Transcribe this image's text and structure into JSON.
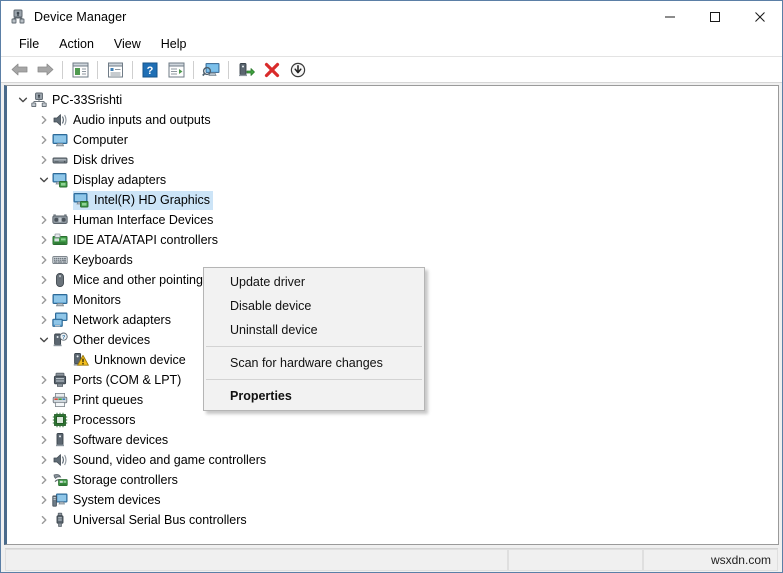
{
  "window": {
    "title": "Device Manager",
    "icon": "device-manager-icon",
    "controls": {
      "minimize": "minimize-icon",
      "maximize": "maximize-icon",
      "close": "close-icon"
    }
  },
  "menubar": {
    "items": [
      {
        "label": "File"
      },
      {
        "label": "Action"
      },
      {
        "label": "View"
      },
      {
        "label": "Help"
      }
    ]
  },
  "toolbar": {
    "buttons": [
      {
        "name": "back-button",
        "icon": "back-arrow-icon"
      },
      {
        "name": "forward-button",
        "icon": "forward-arrow-icon"
      },
      {
        "name": "separator-1",
        "icon": "separator"
      },
      {
        "name": "show-hide-console-tree-button",
        "icon": "console-tree-icon"
      },
      {
        "name": "separator-2",
        "icon": "separator"
      },
      {
        "name": "properties-button",
        "icon": "properties-window-icon"
      },
      {
        "name": "separator-3",
        "icon": "separator"
      },
      {
        "name": "help-button",
        "icon": "help-question-icon"
      },
      {
        "name": "show-hide-action-pane-button",
        "icon": "action-pane-icon"
      },
      {
        "name": "separator-4",
        "icon": "separator"
      },
      {
        "name": "scan-hardware-changes-button",
        "icon": "scan-monitor-icon"
      },
      {
        "name": "separator-5",
        "icon": "separator"
      },
      {
        "name": "update-driver-button",
        "icon": "update-driver-icon"
      },
      {
        "name": "uninstall-device-button",
        "icon": "red-x-icon"
      },
      {
        "name": "disable-device-button",
        "icon": "disable-down-arrow-icon"
      }
    ]
  },
  "tree": {
    "nodes": [
      {
        "label": "PC-33Srishti",
        "indent": 0,
        "expander": "expanded",
        "icon": "computer-root-icon",
        "selected": false
      },
      {
        "label": "Audio inputs and outputs",
        "indent": 1,
        "expander": "collapsed",
        "icon": "speaker-icon",
        "selected": false
      },
      {
        "label": "Computer",
        "indent": 1,
        "expander": "collapsed",
        "icon": "monitor-icon",
        "selected": false
      },
      {
        "label": "Disk drives",
        "indent": 1,
        "expander": "collapsed",
        "icon": "disk-drive-icon",
        "selected": false
      },
      {
        "label": "Display adapters",
        "indent": 1,
        "expander": "expanded",
        "icon": "display-adapter-icon",
        "selected": false
      },
      {
        "label": "Intel(R) HD Graphics",
        "indent": 2,
        "expander": "none",
        "icon": "display-adapter-icon",
        "selected": true
      },
      {
        "label": "Human Interface Devices",
        "indent": 1,
        "expander": "collapsed",
        "icon": "hid-icon",
        "selected": false
      },
      {
        "label": "IDE ATA/ATAPI controllers",
        "indent": 1,
        "expander": "collapsed",
        "icon": "ide-controller-icon",
        "selected": false
      },
      {
        "label": "Keyboards",
        "indent": 1,
        "expander": "collapsed",
        "icon": "keyboard-icon",
        "selected": false
      },
      {
        "label": "Mice and other pointing devices",
        "indent": 1,
        "expander": "collapsed",
        "icon": "mouse-icon",
        "selected": false
      },
      {
        "label": "Monitors",
        "indent": 1,
        "expander": "collapsed",
        "icon": "monitor-icon",
        "selected": false
      },
      {
        "label": "Network adapters",
        "indent": 1,
        "expander": "collapsed",
        "icon": "network-adapter-icon",
        "selected": false
      },
      {
        "label": "Other devices",
        "indent": 1,
        "expander": "expanded",
        "icon": "other-device-icon",
        "selected": false
      },
      {
        "label": "Unknown device",
        "indent": 2,
        "expander": "none",
        "icon": "unknown-device-warning-icon",
        "selected": false
      },
      {
        "label": "Ports (COM & LPT)",
        "indent": 1,
        "expander": "collapsed",
        "icon": "port-icon",
        "selected": false
      },
      {
        "label": "Print queues",
        "indent": 1,
        "expander": "collapsed",
        "icon": "printer-icon",
        "selected": false
      },
      {
        "label": "Processors",
        "indent": 1,
        "expander": "collapsed",
        "icon": "processor-icon",
        "selected": false
      },
      {
        "label": "Software devices",
        "indent": 1,
        "expander": "collapsed",
        "icon": "software-device-icon",
        "selected": false
      },
      {
        "label": "Sound, video and game controllers",
        "indent": 1,
        "expander": "collapsed",
        "icon": "speaker-icon",
        "selected": false
      },
      {
        "label": "Storage controllers",
        "indent": 1,
        "expander": "collapsed",
        "icon": "storage-controller-icon",
        "selected": false
      },
      {
        "label": "System devices",
        "indent": 1,
        "expander": "collapsed",
        "icon": "system-device-icon",
        "selected": false
      },
      {
        "label": "Universal Serial Bus controllers",
        "indent": 1,
        "expander": "collapsed",
        "icon": "usb-icon",
        "selected": false
      }
    ]
  },
  "context_menu": {
    "visible": true,
    "items": [
      {
        "label": "Update driver",
        "type": "item",
        "bold": false
      },
      {
        "label": "Disable device",
        "type": "item",
        "bold": false
      },
      {
        "label": "Uninstall device",
        "type": "item",
        "bold": false
      },
      {
        "label": "",
        "type": "separator",
        "bold": false
      },
      {
        "label": "Scan for hardware changes",
        "type": "item",
        "bold": false
      },
      {
        "label": "",
        "type": "separator",
        "bold": false
      },
      {
        "label": "Properties",
        "type": "item",
        "bold": true
      }
    ]
  },
  "statusbar": {
    "main_text": "",
    "mid_text": "",
    "watermark": "wsxdn.com"
  },
  "colors": {
    "selection": "#cce4f7",
    "title_bar": "#ffffff",
    "window_border": "#5b7fa6",
    "tree_accent_border": "#4a6a8a",
    "menu_bg": "#f2f2f2",
    "toolbar_red": "#d92b2b",
    "icon_green": "#3c9a3c",
    "icon_blue": "#4a90c4"
  }
}
